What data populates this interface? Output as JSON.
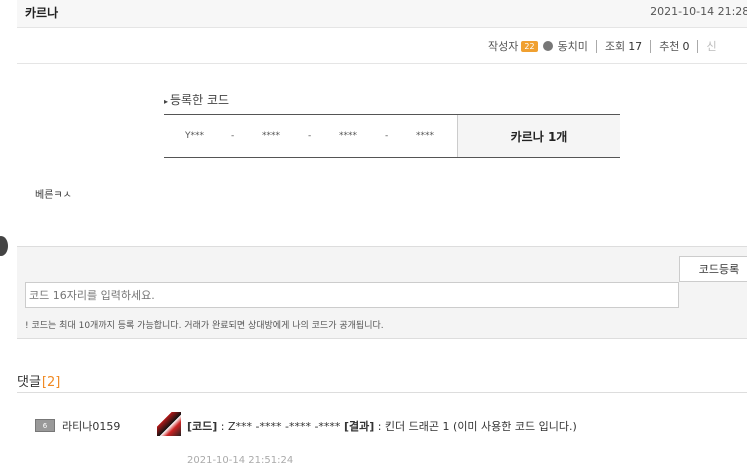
{
  "post": {
    "title": "카르나",
    "date": "2021-10-14 21:28:"
  },
  "meta": {
    "author_label": "작성자",
    "author_level": "22",
    "author_name": "동치미",
    "views_label": "조회",
    "views": "17",
    "likes_label": "추천",
    "likes": "0",
    "more_cut": "신"
  },
  "code_section": {
    "title": "등록한 코드",
    "segments": [
      "Y***",
      "-",
      "****",
      "-",
      "****",
      "-",
      "****"
    ],
    "item": "카르나 1개"
  },
  "body": {
    "text": "베른ㅋㅅ"
  },
  "register": {
    "placeholder": "코드 16자리를 입력하세요.",
    "button_label": "코드등록",
    "notice": "! 코드는 최대 10개까지 등록 가능합니다. 거래가 완료되면 상대방에게 나의 코드가 공개됩니다."
  },
  "comments_header": {
    "label": "댓글",
    "count": "[2]"
  },
  "comments": [
    {
      "level": "6",
      "author": "라티나0159",
      "code_tag": "[코드]",
      "code_value": " : Z*** -**** -**** -**** ",
      "result_tag": "[결과]",
      "result_value": " : 킨더 드래곤 1 (이미 사용한 코드 입니다.)",
      "date": "2021-10-14 21:51:24"
    }
  ],
  "colors": {
    "accent": "#f08a24",
    "badge": "#f0a030"
  }
}
